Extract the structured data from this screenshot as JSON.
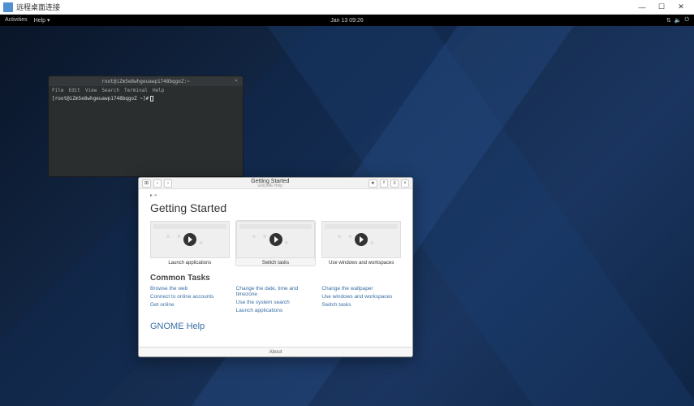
{
  "host_window": {
    "title": "远程桌面连接",
    "minimize": "—",
    "maximize": "☐",
    "close": "✕"
  },
  "topbar": {
    "activities": "Activities",
    "help_menu": "Help ▾",
    "clock": "Jan 13  09:26",
    "tray_net": "⇅",
    "tray_vol": "🔈",
    "tray_power": "⏻"
  },
  "terminal": {
    "title": "root@iZm5e8whgeuawp1748bqgoZ:~",
    "close": "×",
    "menus": [
      "File",
      "Edit",
      "View",
      "Search",
      "Terminal",
      "Help"
    ],
    "prompt": "[root@iZm5e8whgeuawp1748bqgoZ ~]# "
  },
  "help": {
    "header": {
      "grid_icon": "⊞",
      "back": "‹",
      "forward": "›",
      "title": "Getting Started",
      "subtitle": "GNOME Help",
      "bookmark": "★",
      "search": "⌕",
      "menu": "≡",
      "close": "×"
    },
    "crumb_icon": "▸",
    "crumb": "»",
    "h1": "Getting Started",
    "videos": [
      {
        "caption": "Launch applications",
        "selected": false
      },
      {
        "caption": "Switch tasks",
        "selected": true
      },
      {
        "caption": "Use windows and workspaces",
        "selected": false
      }
    ],
    "common_tasks_h": "Common Tasks",
    "tasks_cols": [
      [
        "Browse the web",
        "Connect to online accounts",
        "Get online"
      ],
      [
        "Change the date, time and timezone",
        "Use the system search",
        "Launch applications"
      ],
      [
        "Change the wallpaper",
        "Use windows and workspaces",
        "Switch tasks"
      ]
    ],
    "gnome_help": "GNOME Help",
    "footer": "About"
  }
}
